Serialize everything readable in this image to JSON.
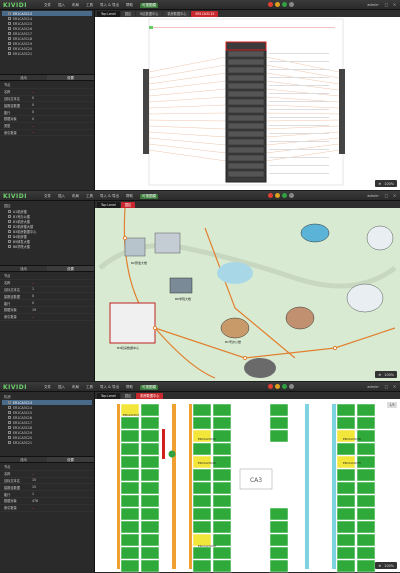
{
  "app": {
    "logo": "KIVIDI"
  },
  "menu": [
    "文件",
    "插入",
    "布局",
    "工具",
    "导入 & 导出",
    "帮助"
  ],
  "menu_active": "可视图模",
  "user": "admin",
  "pane1": {
    "tree": [
      "ER1CA3C13",
      "ER1CA3C14",
      "ER1CA3C15",
      "ER1CA3C16",
      "ER1CA3C17",
      "ER1CA3C18",
      "ER1CA3C19",
      "ER1CA3C20",
      "ER1CA3C21"
    ],
    "tree_selected": 0,
    "tabs": [
      "通用",
      "设置"
    ],
    "props": [
      {
        "k": "节点",
        "v": ""
      },
      {
        "k": "名称",
        "v": "--",
        "red": true
      },
      {
        "k": "目标文本名",
        "v": "0"
      },
      {
        "k": "接数目数据",
        "v": "0"
      },
      {
        "k": "能行",
        "v": "0"
      },
      {
        "k": "数据对象",
        "v": "0"
      },
      {
        "k": "类型",
        "v": "--",
        "red": true
      },
      {
        "k": "索引数量",
        "v": "--",
        "red": true
      }
    ],
    "tabs_main": [
      "Top Level",
      "园区",
      "B区数据中心",
      "机房数据中心",
      "ER1CA3C15"
    ],
    "zoom": "100%"
  },
  "pane2": {
    "tree_head": "园区",
    "tree": [
      "A1机房楼",
      "B1号办公楼",
      "B1机房大楼",
      "B2机房楼大楼",
      "B3机房数据中心",
      "B4机房楼",
      "B5研发大楼",
      "B6学院大楼"
    ],
    "tabs": [
      "通用",
      "设置"
    ],
    "props": [
      {
        "k": "节点",
        "v": ""
      },
      {
        "k": "名称",
        "v": "--",
        "red": true
      },
      {
        "k": "目标文本名",
        "v": "1"
      },
      {
        "k": "接数目数据",
        "v": "0"
      },
      {
        "k": "能行",
        "v": "0"
      },
      {
        "k": "数据对象",
        "v": "19"
      },
      {
        "k": "索引数量",
        "v": "--",
        "red": true
      }
    ],
    "tabs_main": [
      "Top Level",
      "园区"
    ],
    "zoom": "100%",
    "labels": [
      "B2研发大楼",
      "B6学院大楼",
      "B1号办公楼",
      "B3机房数据中心"
    ]
  },
  "pane3": {
    "tree_head": "机房",
    "tree": [
      "ER1CA3C13",
      "ER1CA3C14",
      "ER1CA3C15",
      "ER1CA3C16",
      "ER1CA3C17",
      "ER1CA3C18",
      "ER1CA3C19",
      "ER1CA3C20",
      "ER1CA3C21"
    ],
    "tabs": [
      "通用",
      "设置"
    ],
    "props": [
      {
        "k": "节点",
        "v": ""
      },
      {
        "k": "名称",
        "v": "--",
        "red": true
      },
      {
        "k": "目标文本名",
        "v": "15"
      },
      {
        "k": "接数目数据",
        "v": "15"
      },
      {
        "k": "能行",
        "v": "1"
      },
      {
        "k": "数据对象",
        "v": "476"
      },
      {
        "k": "索引数量",
        "v": "--",
        "red": true
      }
    ],
    "tabs_main": [
      "Top Level",
      "园区",
      "机房数据中心"
    ],
    "zoom": "100%",
    "rack_labels": [
      "ER1CA3C3",
      "ER1CA3C15",
      "ER1CA3C16",
      "ER1CA3C20",
      "ER1CA3C36",
      "ER1CA3C35",
      "CA3"
    ],
    "page_num": "1/3"
  }
}
